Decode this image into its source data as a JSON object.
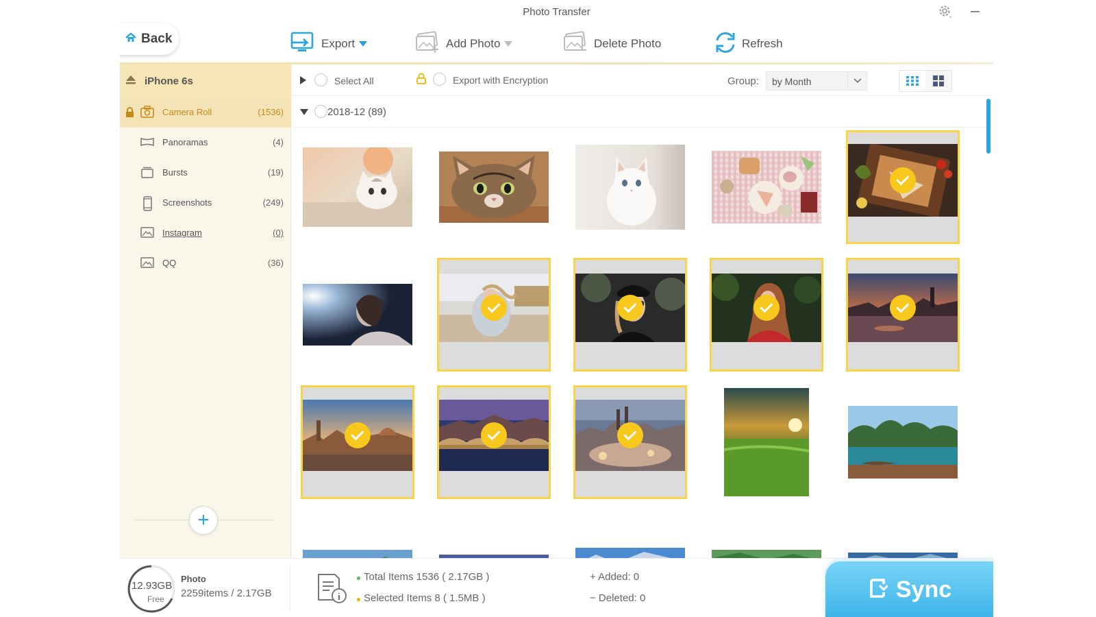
{
  "window": {
    "title": "Photo Transfer"
  },
  "header": {
    "back_label": "Back"
  },
  "toolbar": {
    "export_label": "Export",
    "add_photo_label": "Add Photo",
    "delete_photo_label": "Delete Photo",
    "refresh_label": "Refresh"
  },
  "sidebar": {
    "device_name": "iPhone 6s",
    "albums": [
      {
        "name": "Camera Roll",
        "count": "(1536)",
        "icon": "camera-icon",
        "active": true
      },
      {
        "name": "Panoramas",
        "count": "(4)",
        "icon": "panorama-icon"
      },
      {
        "name": "Bursts",
        "count": "(19)",
        "icon": "bursts-icon"
      },
      {
        "name": "Screenshots",
        "count": "(249)",
        "icon": "phone-icon"
      },
      {
        "name": "Instagram",
        "count": "(0)",
        "icon": "image-icon"
      },
      {
        "name": "QQ",
        "count": "(36)",
        "icon": "image-icon"
      }
    ],
    "add_label": "+"
  },
  "options": {
    "select_all": "Select All",
    "export_encryption": "Export with Encryption",
    "group_label": "Group:",
    "group_value": "by Month"
  },
  "group": {
    "label": "2018-12 (89)"
  },
  "photos": [
    {
      "subject": "kitten on bed",
      "selected": false
    },
    {
      "subject": "tabby cat face",
      "selected": false
    },
    {
      "subject": "white kitten",
      "selected": false
    },
    {
      "subject": "breakfast table",
      "selected": false
    },
    {
      "subject": "food tray",
      "selected": true
    },
    {
      "subject": "woman portrait",
      "selected": false
    },
    {
      "subject": "woman on beach",
      "selected": true
    },
    {
      "subject": "woman with cap",
      "selected": true
    },
    {
      "subject": "woman red sweater",
      "selected": true
    },
    {
      "subject": "city river sunset",
      "selected": true
    },
    {
      "subject": "florence skyline",
      "selected": true
    },
    {
      "subject": "bridge at night",
      "selected": true
    },
    {
      "subject": "old town square",
      "selected": true
    },
    {
      "subject": "field sunset",
      "selected": false
    },
    {
      "subject": "lake mountains",
      "selected": false
    }
  ],
  "status": {
    "storage_size": "12.93GB",
    "storage_free": "Free",
    "photo_title": "Photo",
    "photo_detail": "2259items / 2.17GB",
    "total_items": "Total Items 1536 ( 2.17GB )",
    "selected_items": "Selected Items 8 ( 1.5MB )",
    "added": "+ Added: 0",
    "deleted": "− Deleted: 0"
  },
  "sync_label": "Sync",
  "colors": {
    "accent": "#2aa5df",
    "selection": "#f8d44a",
    "check": "#f8c81c",
    "sidebar_active": "#f3e3b6"
  }
}
